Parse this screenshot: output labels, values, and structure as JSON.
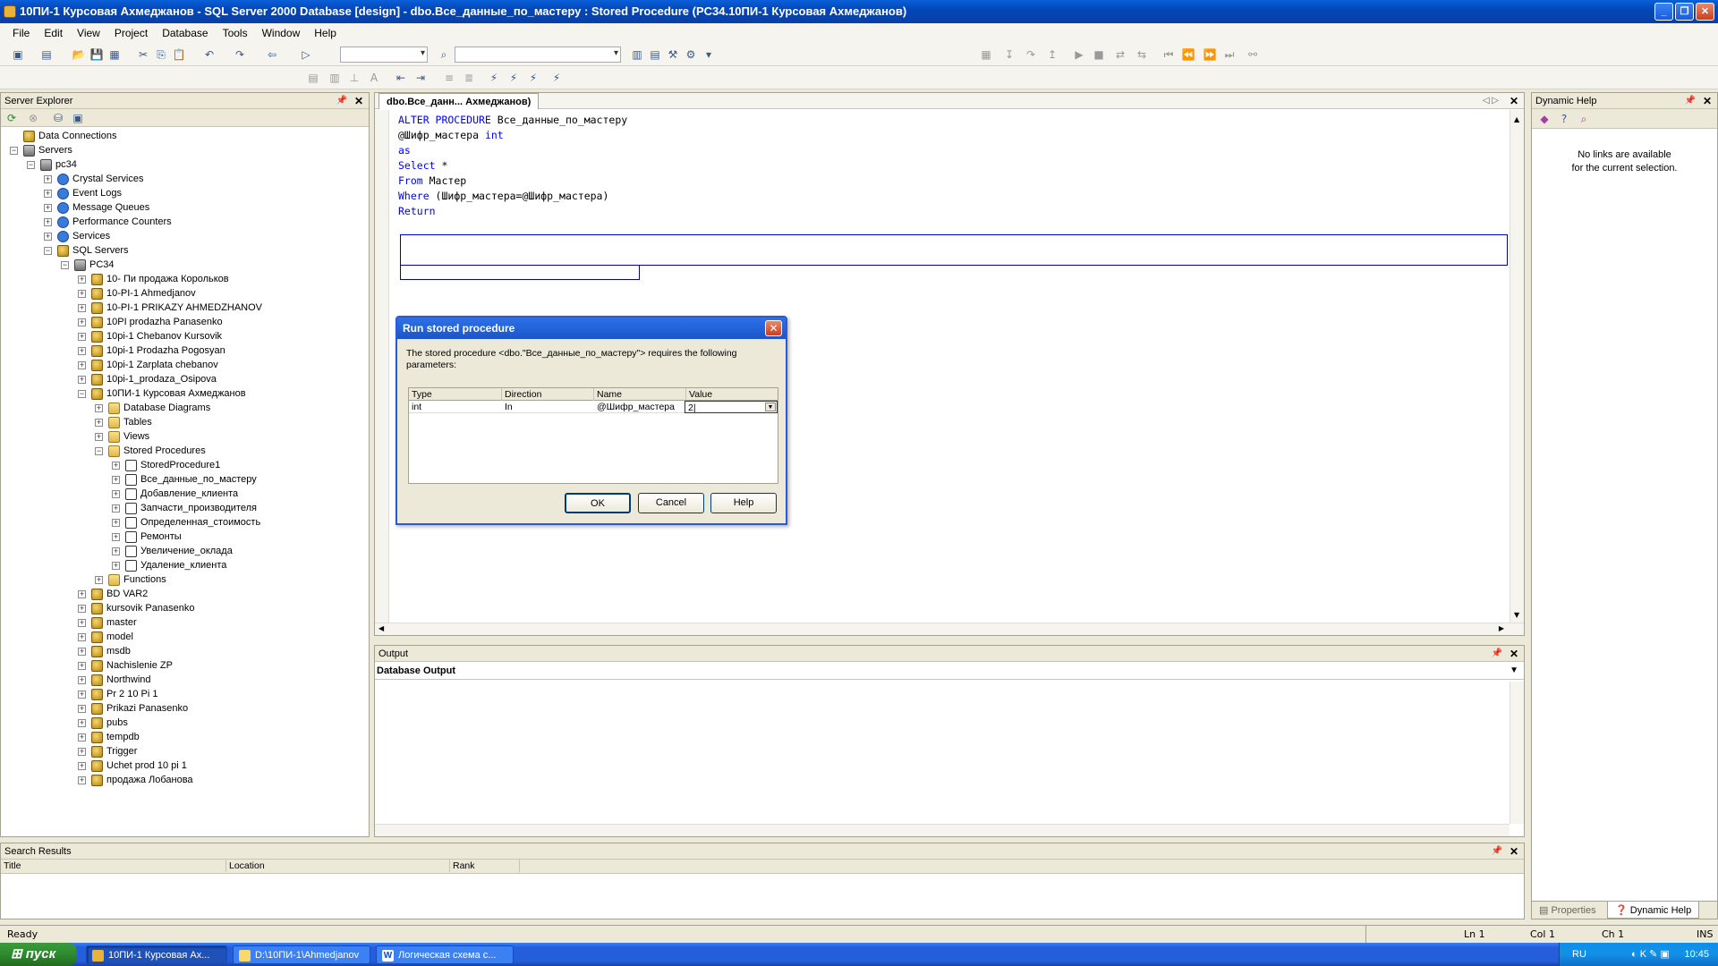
{
  "window": {
    "title": "10ПИ-1 Курсовая Ахмеджанов - SQL Server 2000 Database [design] - dbo.Все_данные_по_мастеру : Stored Procedure (PC34.10ПИ-1 Курсовая Ахмеджанов)"
  },
  "menu": [
    "File",
    "Edit",
    "View",
    "Project",
    "Database",
    "Tools",
    "Window",
    "Help"
  ],
  "server_explorer": {
    "title": "Server Explorer",
    "tree": [
      {
        "label": "Data Connections",
        "level": 0
      },
      {
        "label": "Servers",
        "level": 0
      },
      {
        "label": "pc34",
        "level": 1
      },
      {
        "label": "Crystal Services",
        "level": 2
      },
      {
        "label": "Event Logs",
        "level": 2
      },
      {
        "label": "Message Queues",
        "level": 2
      },
      {
        "label": "Performance Counters",
        "level": 2
      },
      {
        "label": "Services",
        "level": 2
      },
      {
        "label": "SQL Servers",
        "level": 2
      },
      {
        "label": "PC34",
        "level": 3
      },
      {
        "label": "10- Пи продажа Корольков",
        "level": 4
      },
      {
        "label": "10-PI-1 Ahmedjanov",
        "level": 4
      },
      {
        "label": "10-PI-1 PRIKAZY AHMEDZHANOV",
        "level": 4
      },
      {
        "label": "10PI prodazha Panasenko",
        "level": 4
      },
      {
        "label": "10pi-1 Chebanov Kursovik",
        "level": 4
      },
      {
        "label": "10pi-1 Prodazha Pogosyan",
        "level": 4
      },
      {
        "label": "10pi-1 Zarplata chebanov",
        "level": 4
      },
      {
        "label": "10pi-1_prodaza_Osipova",
        "level": 4
      },
      {
        "label": "10ПИ-1 Курсовая Ахмеджанов",
        "level": 4
      },
      {
        "label": "Database Diagrams",
        "level": 5
      },
      {
        "label": "Tables",
        "level": 5
      },
      {
        "label": "Views",
        "level": 5
      },
      {
        "label": "Stored Procedures",
        "level": 5
      },
      {
        "label": "StoredProcedure1",
        "level": 6
      },
      {
        "label": "Все_данные_по_мастеру",
        "level": 6
      },
      {
        "label": "Добавление_клиента",
        "level": 6
      },
      {
        "label": "Запчасти_производителя",
        "level": 6
      },
      {
        "label": "Определенная_стоимость",
        "level": 6
      },
      {
        "label": "Ремонты",
        "level": 6
      },
      {
        "label": "Увеличение_оклада",
        "level": 6
      },
      {
        "label": "Удаление_клиента",
        "level": 6
      },
      {
        "label": "Functions",
        "level": 5
      },
      {
        "label": "BD VAR2",
        "level": 4
      },
      {
        "label": "kursovik Panasenko",
        "level": 4
      },
      {
        "label": "master",
        "level": 4
      },
      {
        "label": "model",
        "level": 4
      },
      {
        "label": "msdb",
        "level": 4
      },
      {
        "label": "Nachislenie ZP",
        "level": 4
      },
      {
        "label": "Northwind",
        "level": 4
      },
      {
        "label": "Pr 2 10 Pi 1",
        "level": 4
      },
      {
        "label": "Prikazi  Panasenko",
        "level": 4
      },
      {
        "label": "pubs",
        "level": 4
      },
      {
        "label": "tempdb",
        "level": 4
      },
      {
        "label": "Trigger",
        "level": 4
      },
      {
        "label": "Uchet prod 10 pi 1",
        "level": 4
      },
      {
        "label": "продажа Лобанова",
        "level": 4
      }
    ]
  },
  "editor": {
    "tab": "dbo.Все_данн... Ахмеджанов)",
    "lines": [
      {
        "kw": "ALTER PROCEDURE",
        "rest": " Все_данные_по_мастеру"
      },
      {
        "kw": "",
        "rest": "@Шифр_мастера ",
        "kw2": "int"
      },
      {
        "kw": "as",
        "rest": ""
      },
      {
        "kw": "Select",
        "rest": " *"
      },
      {
        "kw": "From",
        "rest": " Мастер"
      },
      {
        "kw": "Where",
        "rest": " (Шифр_мастера=@Шифр_мастера)"
      },
      {
        "kw": "Return",
        "rest": ""
      }
    ]
  },
  "dynamic_help": {
    "title": "Dynamic Help",
    "message_line1": "No links are available",
    "message_line2": "for the current selection.",
    "tab_properties": "Properties",
    "tab_help": "Dynamic Help"
  },
  "output": {
    "title": "Output",
    "pane": "Database Output"
  },
  "search_results": {
    "title": "Search Results",
    "columns": [
      "Title",
      "Location",
      "Rank"
    ]
  },
  "dialog": {
    "title": "Run stored procedure",
    "message": "The stored procedure <dbo.\"Все_данные_по_мастеру\"> requires the following parameters:",
    "columns": [
      "Type",
      "Direction",
      "Name",
      "Value"
    ],
    "row": {
      "type": "int",
      "direction": "In",
      "name": "@Шифр_мастера",
      "value": "2"
    },
    "ok": "OK",
    "cancel": "Cancel",
    "help": "Help"
  },
  "statusbar": {
    "text": "Ready",
    "ln": "Ln 1",
    "col": "Col 1",
    "ch": "Ch 1",
    "ins": "INS"
  },
  "taskbar": {
    "start": "пуск",
    "tasks": [
      "10ПИ-1 Курсовая Ах...",
      "D:\\10ПИ-1\\Ahmedjanov",
      "Логическая схема с..."
    ],
    "lang": "RU",
    "time": "10:45"
  }
}
